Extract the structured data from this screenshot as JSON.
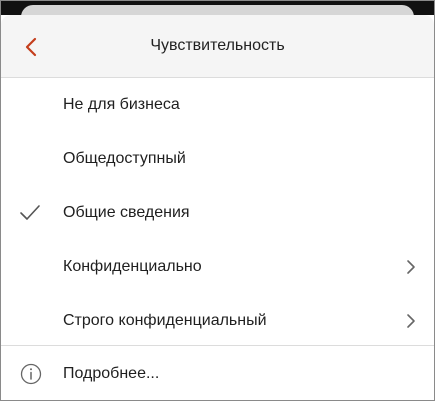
{
  "header": {
    "title": "Чувствительность",
    "back_icon": "chevron-left-icon",
    "accent_color": "#C43E1C"
  },
  "items": [
    {
      "label": "Не для бизнеса",
      "checked": false,
      "has_submenu": false
    },
    {
      "label": "Общедоступный",
      "checked": false,
      "has_submenu": false
    },
    {
      "label": "Общие сведения",
      "checked": true,
      "has_submenu": false
    },
    {
      "label": "Конфиденциально",
      "checked": false,
      "has_submenu": true
    },
    {
      "label": "Строго конфиденциальный",
      "checked": false,
      "has_submenu": true
    }
  ],
  "footer": {
    "more_label": "Подробнее...",
    "icon": "info-icon"
  }
}
